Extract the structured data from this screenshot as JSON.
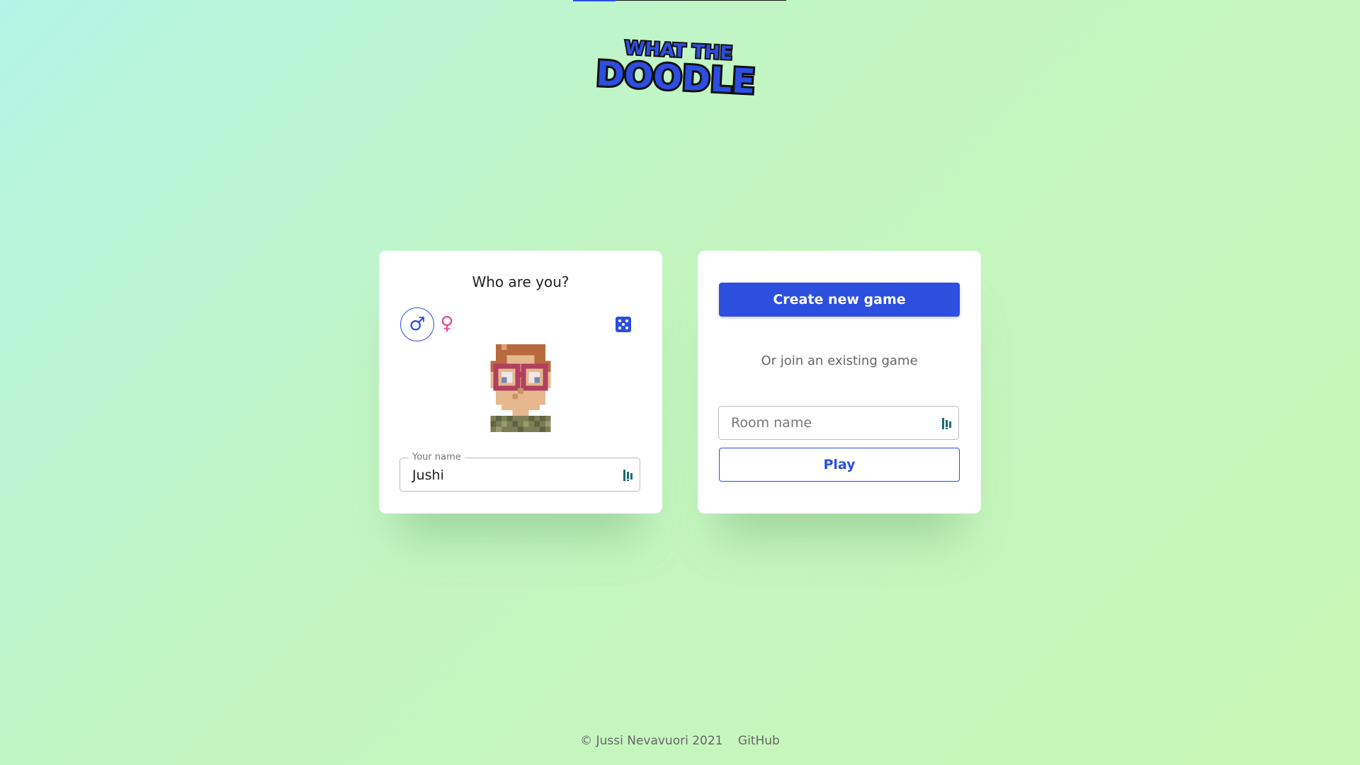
{
  "app": {
    "logo_alt": "WHAT THE DOODLE",
    "logo_top": "WHAT THE",
    "logo_bottom": "DOODLE"
  },
  "progress": {
    "value": 0.2
  },
  "profile": {
    "title": "Who are you?",
    "gender_options": [
      {
        "icon": "male-symbol-icon",
        "glyph": "♂",
        "selected": true
      },
      {
        "icon": "female-symbol-icon",
        "glyph": "♀",
        "selected": false
      }
    ],
    "randomize_icon": "dice-icon",
    "avatar_icon": "pixel-avatar-icon",
    "name_field": {
      "label": "Your name",
      "value": "Jushi"
    }
  },
  "join": {
    "create_label": "Create new game",
    "or_text": "Or join an existing game",
    "room_field": {
      "placeholder": "Room name"
    },
    "play_label": "Play"
  },
  "footer": {
    "copyright": "© Jussi Nevavuori 2021",
    "github": "GitHub"
  },
  "colors": {
    "accent": "#2c4fe0",
    "female": "#e0508f"
  }
}
